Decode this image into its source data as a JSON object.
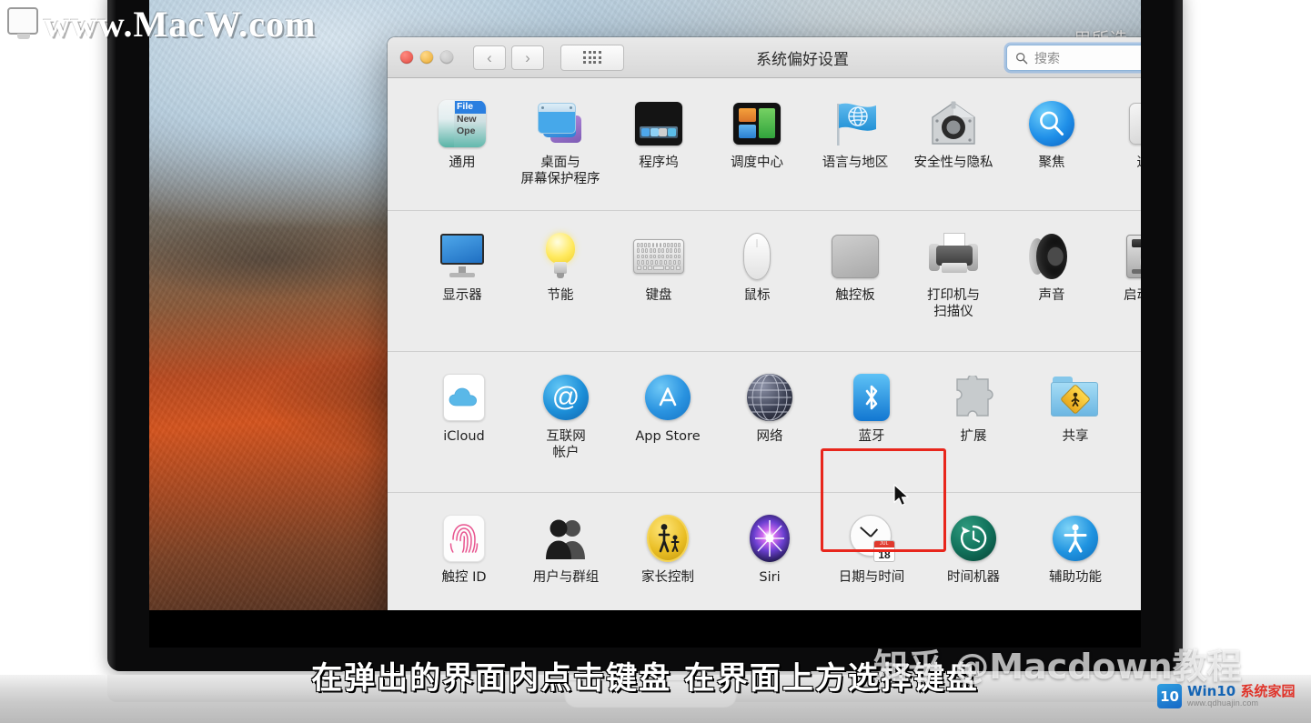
{
  "watermarks": {
    "top_left_site": "www.MacW.com",
    "zhihu": "知乎 @Macdown教程",
    "win10_name": "Win10",
    "win10_name_cn": "系统家园",
    "win10_url": "www.qdhuajin.com",
    "win10_logo_text": "10"
  },
  "subtitle": "在弹出的界面内点击键盘 在界面上方选择键盘",
  "desktop": {
    "menu_fragment": "用所选"
  },
  "window": {
    "title": "系统偏好设置",
    "search": {
      "placeholder": "搜索",
      "value": ""
    },
    "nav": {
      "back": "‹",
      "forward": "›"
    },
    "grid_button": "show-all-grid"
  },
  "highlight": {
    "target_label": "键盘",
    "color": "#e8261c"
  },
  "rows": [
    {
      "name": "personal",
      "items": [
        {
          "label": "通用",
          "icon": "general-icon"
        },
        {
          "label": "桌面与\n屏幕保护程序",
          "label_line1": "桌面与",
          "label_line2": "屏幕保护程序",
          "icon": "desktop-screensaver-icon"
        },
        {
          "label": "程序坞",
          "icon": "dock-icon"
        },
        {
          "label": "调度中心",
          "icon": "mission-control-icon"
        },
        {
          "label": "语言与地区",
          "icon": "language-region-icon"
        },
        {
          "label": "安全性与隐私",
          "icon": "security-privacy-icon"
        },
        {
          "label": "聚焦",
          "icon": "spotlight-icon"
        },
        {
          "label": "通知",
          "icon": "notifications-icon"
        }
      ]
    },
    {
      "name": "hardware",
      "items": [
        {
          "label": "显示器",
          "icon": "displays-icon"
        },
        {
          "label": "节能",
          "icon": "energy-saver-icon"
        },
        {
          "label": "键盘",
          "icon": "keyboard-icon"
        },
        {
          "label": "鼠标",
          "icon": "mouse-icon"
        },
        {
          "label": "触控板",
          "icon": "trackpad-icon"
        },
        {
          "label": "打印机与\n扫描仪",
          "label_line1": "打印机与",
          "label_line2": "扫描仪",
          "icon": "printers-scanners-icon"
        },
        {
          "label": "声音",
          "icon": "sound-icon"
        },
        {
          "label": "启动磁盘",
          "icon": "startup-disk-icon"
        }
      ]
    },
    {
      "name": "internet-wireless",
      "items": [
        {
          "label": "iCloud",
          "icon": "icloud-icon"
        },
        {
          "label": "互联网\n帐户",
          "label_line1": "互联网",
          "label_line2": "帐户",
          "icon": "internet-accounts-icon"
        },
        {
          "label": "App Store",
          "icon": "app-store-icon"
        },
        {
          "label": "网络",
          "icon": "network-icon"
        },
        {
          "label": "蓝牙",
          "icon": "bluetooth-icon"
        },
        {
          "label": "扩展",
          "icon": "extensions-icon"
        },
        {
          "label": "共享",
          "icon": "sharing-icon"
        }
      ]
    },
    {
      "name": "system",
      "items": [
        {
          "label": "触控 ID",
          "icon": "touch-id-icon"
        },
        {
          "label": "用户与群组",
          "icon": "users-groups-icon"
        },
        {
          "label": "家长控制",
          "icon": "parental-controls-icon"
        },
        {
          "label": "Siri",
          "icon": "siri-icon"
        },
        {
          "label": "日期与时间",
          "icon": "date-time-icon"
        },
        {
          "label": "时间机器",
          "icon": "time-machine-icon"
        },
        {
          "label": "辅助功能",
          "icon": "accessibility-icon"
        }
      ]
    }
  ],
  "icon_details": {
    "general_menu": {
      "line1": "File",
      "line2": "New",
      "line3": "Ope"
    },
    "date_icon": {
      "month": "JUL",
      "day": "18"
    }
  }
}
